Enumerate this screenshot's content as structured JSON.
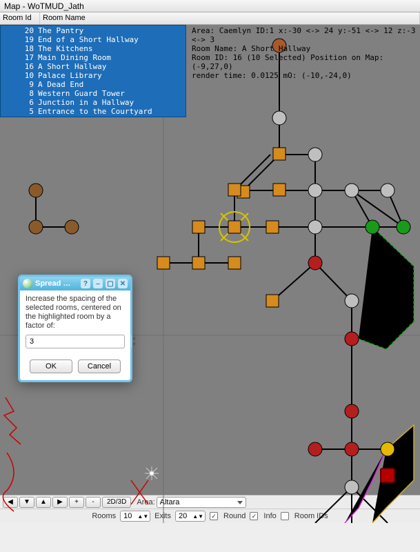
{
  "window": {
    "title": "Map - WoTMUD_Jath"
  },
  "columns": {
    "id": "Room Id",
    "name": "Room Name",
    "sort_indicator": "▲"
  },
  "rooms": [
    {
      "id": "20",
      "name": "The Pantry"
    },
    {
      "id": "19",
      "name": "End of a Short Hallway"
    },
    {
      "id": "18",
      "name": "The Kitchens"
    },
    {
      "id": "17",
      "name": "Main Dining Room"
    },
    {
      "id": "16",
      "name": "A Short Hallway"
    },
    {
      "id": "10",
      "name": "Palace Library"
    },
    {
      "id": "9",
      "name": "A Dead End"
    },
    {
      "id": "8",
      "name": "Western Guard Tower"
    },
    {
      "id": "6",
      "name": "Junction in a Hallway"
    },
    {
      "id": "5",
      "name": "Entrance to the Courtyard"
    }
  ],
  "info": {
    "line1": "Area: Caemlyn ID:1 x:-30 <-> 24 y:-51 <-> 12 z:-3 <-> 3",
    "line2": "Room Name: A Short Hallway",
    "line3": "Room ID: 16 (10 Selected) Position on Map: (-9,27,0)",
    "line4": "render time: 0.0125 mO: (-10,-24,0)"
  },
  "dialog": {
    "title": "Spread …",
    "body": "Increase the spacing of the selected rooms, centered on the highlighted room by a factor of:",
    "value": "3",
    "ok": "OK",
    "cancel": "Cancel"
  },
  "bottombar": {
    "btn_left": "◀",
    "btn_down": "▼",
    "btn_up": "▲",
    "btn_right": "▶",
    "btn_plus": "+",
    "btn_minus": "-",
    "btn_2d3d": "2D/3D",
    "area_label": "Area:",
    "area_value": "Altara",
    "rooms_label": "Rooms",
    "rooms_value": "10",
    "exits_label": "Exits",
    "exits_value": "20",
    "round_label": "Round",
    "info_label": "Info",
    "roomids_label": "Room IDs",
    "round_checked": true,
    "info_checked": true,
    "roomids_checked": false
  },
  "colors": {
    "orange": "#d68b1e",
    "grey": "#bfbfbf",
    "green": "#1a9a1a",
    "red": "#b51e1e",
    "yellow": "#e6b800",
    "brown": "#8a5a2a",
    "darkred": "#8a1010"
  }
}
